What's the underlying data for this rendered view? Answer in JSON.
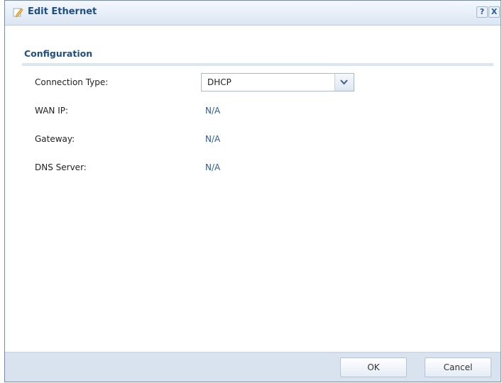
{
  "dialog": {
    "title": "Edit Ethernet",
    "help_label": "?",
    "close_label": "X"
  },
  "section": {
    "title": "Configuration"
  },
  "form": {
    "connection_type_label": "Connection Type:",
    "connection_type_value": "DHCP",
    "wan_ip_label": "WAN IP:",
    "wan_ip_value": "N/A",
    "gateway_label": "Gateway:",
    "gateway_value": "N/A",
    "dns_server_label": "DNS Server:",
    "dns_server_value": "N/A"
  },
  "footer": {
    "ok_label": "OK",
    "cancel_label": "Cancel"
  },
  "colors": {
    "accent": "#1f4e8c",
    "value_text": "#2a5d9e",
    "footer_bg": "#d9e3ef"
  },
  "icons": {
    "title": "edit-pencil-icon",
    "dropdown": "chevron-down-icon"
  }
}
